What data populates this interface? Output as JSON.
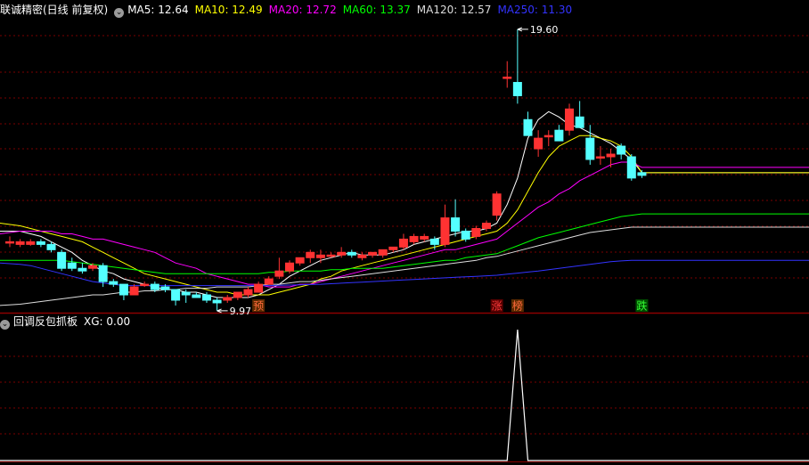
{
  "main_panel": {
    "title": "联诚精密(日线 前复权)",
    "menu_icon": "chevron-down-icon",
    "ma_legend": [
      {
        "label": "MA5: 12.64",
        "color": "#ffffff"
      },
      {
        "label": "MA10: 12.49",
        "color": "#ffff00"
      },
      {
        "label": "MA20: 12.72",
        "color": "#ff00ff"
      },
      {
        "label": "MA60: 13.37",
        "color": "#00ff00"
      },
      {
        "label": "MA120: 12.57",
        "color": "#dddddd"
      },
      {
        "label": "MA250: 11.30",
        "color": "#3333ff"
      }
    ],
    "high_label": "19.60",
    "low_label": "9.97",
    "markers": [
      {
        "text": "预",
        "bar": 24,
        "color": "#ff6a3c",
        "bg": "#5a2a00"
      },
      {
        "text": "涨",
        "bar": 47,
        "color": "#ff3b3b",
        "bg": "#5a0000"
      },
      {
        "text": "榜",
        "bar": 49,
        "color": "#ff6a3c",
        "bg": "#5a2a00"
      },
      {
        "text": "跌",
        "bar": 61,
        "color": "#33ff33",
        "bg": "#004d00"
      }
    ]
  },
  "sub_panel": {
    "title": "回调反包抓板",
    "xg_label": "XG: 0.00",
    "menu_icon": "chevron-down-icon"
  },
  "colors": {
    "up": "#ff3232",
    "down": "#54ffff",
    "grid": "#7a0000",
    "frame": "#8b0000"
  },
  "chart_data": {
    "type": "candlestick",
    "price_range": [
      9.5,
      20.1
    ],
    "ohlc": [
      [
        11.6,
        11.8,
        11.4,
        11.6
      ],
      [
        11.5,
        11.7,
        11.4,
        11.6
      ],
      [
        11.5,
        11.7,
        11.45,
        11.6
      ],
      [
        11.6,
        11.7,
        11.4,
        11.5
      ],
      [
        11.5,
        11.6,
        11.2,
        11.3
      ],
      [
        11.2,
        11.3,
        10.5,
        10.6
      ],
      [
        10.8,
        11.0,
        10.5,
        10.6
      ],
      [
        10.6,
        10.8,
        10.4,
        10.5
      ],
      [
        10.6,
        10.8,
        10.5,
        10.7
      ],
      [
        10.7,
        10.8,
        9.9,
        10.1
      ],
      [
        10.1,
        10.2,
        9.9,
        10.0
      ],
      [
        10.0,
        10.0,
        9.4,
        9.6
      ],
      [
        9.6,
        10.0,
        9.6,
        9.9
      ],
      [
        10.0,
        10.1,
        9.9,
        10.0
      ],
      [
        10.0,
        10.1,
        9.7,
        9.8
      ],
      [
        9.9,
        10.0,
        9.7,
        9.8
      ],
      [
        9.8,
        9.8,
        9.2,
        9.4
      ],
      [
        9.7,
        9.8,
        9.3,
        9.6
      ],
      [
        9.6,
        9.7,
        9.5,
        9.5
      ],
      [
        9.6,
        9.7,
        9.3,
        9.4
      ],
      [
        9.4,
        9.5,
        9.0,
        9.3
      ],
      [
        9.4,
        9.6,
        9.3,
        9.5
      ],
      [
        9.5,
        9.7,
        9.4,
        9.7
      ],
      [
        9.6,
        9.9,
        9.5,
        9.8
      ],
      [
        9.7,
        10.1,
        9.7,
        10.0
      ],
      [
        10.0,
        10.3,
        10.0,
        10.2
      ],
      [
        10.3,
        11.0,
        10.2,
        10.5
      ],
      [
        10.5,
        10.9,
        10.4,
        10.8
      ],
      [
        10.8,
        11.0,
        10.7,
        11.0
      ],
      [
        11.0,
        11.3,
        10.8,
        11.2
      ],
      [
        11.0,
        11.3,
        10.8,
        11.1
      ],
      [
        11.1,
        11.2,
        11.0,
        11.1
      ],
      [
        11.1,
        11.4,
        11.0,
        11.2
      ],
      [
        11.2,
        11.3,
        11.0,
        11.1
      ],
      [
        11.0,
        11.2,
        10.9,
        11.1
      ],
      [
        11.1,
        11.2,
        11.0,
        11.2
      ],
      [
        11.1,
        11.3,
        11.0,
        11.3
      ],
      [
        11.3,
        11.4,
        11.2,
        11.4
      ],
      [
        11.4,
        11.9,
        11.3,
        11.7
      ],
      [
        11.6,
        11.9,
        11.5,
        11.8
      ],
      [
        11.7,
        11.9,
        11.6,
        11.8
      ],
      [
        11.7,
        11.8,
        11.3,
        11.5
      ],
      [
        11.5,
        13.0,
        11.4,
        12.5
      ],
      [
        12.5,
        13.2,
        11.8,
        12.0
      ],
      [
        12.0,
        12.1,
        11.6,
        11.7
      ],
      [
        11.8,
        12.2,
        11.7,
        12.1
      ],
      [
        12.1,
        12.4,
        12.0,
        12.3
      ],
      [
        12.6,
        13.5,
        12.4,
        13.4
      ],
      [
        17.8,
        18.4,
        17.4,
        17.8
      ],
      [
        17.6,
        19.6,
        16.8,
        17.1
      ],
      [
        16.2,
        16.5,
        15.6,
        15.6
      ],
      [
        15.1,
        15.8,
        14.8,
        15.5
      ],
      [
        15.6,
        15.8,
        15.2,
        15.6
      ],
      [
        15.8,
        16.0,
        15.5,
        15.4
      ],
      [
        15.8,
        16.8,
        15.6,
        16.6
      ],
      [
        16.3,
        16.9,
        15.9,
        15.9
      ],
      [
        15.5,
        16.0,
        14.5,
        14.7
      ],
      [
        14.8,
        15.2,
        14.5,
        14.8
      ],
      [
        14.8,
        15.1,
        14.4,
        14.9
      ],
      [
        15.2,
        15.3,
        14.7,
        14.9
      ],
      [
        14.8,
        14.9,
        13.9,
        14.0
      ],
      [
        14.2,
        14.3,
        14.0,
        14.1
      ]
    ],
    "ma_series": {
      "MA5": [
        12.0,
        12.0,
        11.9,
        11.8,
        11.6,
        11.4,
        11.2,
        10.9,
        10.7,
        10.5,
        10.4,
        10.2,
        10.1,
        10.0,
        9.9,
        9.8,
        9.8,
        9.7,
        9.7,
        9.6,
        9.5,
        9.5,
        9.5,
        9.5,
        9.6,
        9.8,
        10.0,
        10.3,
        10.5,
        10.7,
        10.9,
        11.0,
        11.1,
        11.2,
        11.1,
        11.1,
        11.1,
        11.2,
        11.3,
        11.5,
        11.6,
        11.7,
        11.8,
        11.9,
        12.0,
        12.0,
        12.1,
        12.3,
        13.0,
        14.0,
        15.5,
        16.2,
        16.5,
        16.3,
        16.0,
        15.9,
        15.7,
        15.5,
        15.3,
        15.0,
        14.7,
        14.2
      ],
      "MA10": [
        12.3,
        12.2,
        12.1,
        12.0,
        11.9,
        11.8,
        11.7,
        11.6,
        11.4,
        11.2,
        11.0,
        10.8,
        10.6,
        10.4,
        10.3,
        10.2,
        10.1,
        10.0,
        9.9,
        9.8,
        9.7,
        9.7,
        9.6,
        9.6,
        9.6,
        9.6,
        9.7,
        9.8,
        9.9,
        10.0,
        10.2,
        10.3,
        10.5,
        10.6,
        10.7,
        10.8,
        10.9,
        11.0,
        11.1,
        11.2,
        11.3,
        11.4,
        11.5,
        11.6,
        11.7,
        11.8,
        11.9,
        12.0,
        12.3,
        12.8,
        13.5,
        14.2,
        14.8,
        15.2,
        15.4,
        15.6,
        15.6,
        15.5,
        15.4,
        15.2,
        14.8,
        14.2
      ],
      "MA20": [
        11.9,
        12.0,
        12.0,
        12.0,
        12.0,
        11.9,
        11.9,
        11.8,
        11.7,
        11.7,
        11.6,
        11.5,
        11.4,
        11.3,
        11.2,
        11.0,
        10.8,
        10.7,
        10.6,
        10.4,
        10.3,
        10.2,
        10.1,
        10.0,
        10.0,
        9.9,
        9.9,
        9.9,
        10.0,
        10.0,
        10.1,
        10.2,
        10.3,
        10.4,
        10.5,
        10.6,
        10.7,
        10.8,
        10.9,
        11.0,
        11.1,
        11.2,
        11.3,
        11.3,
        11.4,
        11.5,
        11.6,
        11.7,
        12.0,
        12.3,
        12.6,
        12.9,
        13.1,
        13.4,
        13.6,
        13.9,
        14.1,
        14.3,
        14.5,
        14.6,
        14.6,
        14.4
      ],
      "MA60": [
        10.9,
        10.9,
        10.9,
        10.9,
        10.9,
        10.9,
        10.85,
        10.8,
        10.75,
        10.7,
        10.65,
        10.6,
        10.55,
        10.5,
        10.45,
        10.4,
        10.4,
        10.4,
        10.4,
        10.4,
        10.4,
        10.4,
        10.4,
        10.4,
        10.4,
        10.45,
        10.45,
        10.5,
        10.5,
        10.5,
        10.5,
        10.55,
        10.55,
        10.6,
        10.6,
        10.6,
        10.6,
        10.65,
        10.7,
        10.75,
        10.8,
        10.85,
        10.9,
        10.9,
        11.0,
        11.05,
        11.1,
        11.15,
        11.3,
        11.45,
        11.6,
        11.75,
        11.85,
        11.95,
        12.05,
        12.15,
        12.25,
        12.35,
        12.45,
        12.55,
        12.6,
        12.65
      ],
      "MA120": [
        9.2,
        9.25,
        9.3,
        9.35,
        9.4,
        9.45,
        9.5,
        9.55,
        9.6,
        9.6,
        9.65,
        9.7,
        9.7,
        9.75,
        9.75,
        9.8,
        9.8,
        9.85,
        9.85,
        9.85,
        9.9,
        9.9,
        9.9,
        9.9,
        9.95,
        10.0,
        10.0,
        10.05,
        10.1,
        10.1,
        10.15,
        10.2,
        10.25,
        10.3,
        10.35,
        10.4,
        10.45,
        10.5,
        10.55,
        10.6,
        10.65,
        10.7,
        10.75,
        10.8,
        10.85,
        10.9,
        11.0,
        11.05,
        11.15,
        11.25,
        11.35,
        11.45,
        11.55,
        11.65,
        11.75,
        11.85,
        11.95,
        12.0,
        12.05,
        12.1,
        12.15,
        12.15
      ],
      "MA250": [
        10.8,
        10.75,
        10.7,
        10.6,
        10.5,
        10.4,
        10.3,
        10.2,
        10.1,
        10.05,
        10.0,
        9.95,
        9.95,
        9.95,
        9.95,
        9.95,
        9.95,
        9.95,
        9.95,
        9.95,
        9.95,
        9.95,
        9.95,
        9.95,
        9.95,
        9.95,
        9.96,
        9.97,
        9.98,
        9.99,
        10.0,
        10.02,
        10.04,
        10.06,
        10.08,
        10.1,
        10.12,
        10.14,
        10.16,
        10.18,
        10.2,
        10.22,
        10.24,
        10.26,
        10.28,
        10.3,
        10.32,
        10.34,
        10.38,
        10.42,
        10.46,
        10.5,
        10.55,
        10.6,
        10.65,
        10.7,
        10.75,
        10.8,
        10.85,
        10.88,
        10.9,
        10.9
      ]
    },
    "xg": {
      "range": [
        0,
        1
      ],
      "values": [
        0,
        0,
        0,
        0,
        0,
        0,
        0,
        0,
        0,
        0,
        0,
        0,
        0,
        0,
        0,
        0,
        0,
        0,
        0,
        0,
        0,
        0,
        0,
        0,
        0,
        0,
        0,
        0,
        0,
        0,
        0,
        0,
        0,
        0,
        0,
        0,
        0,
        0,
        0,
        0,
        0,
        0,
        0,
        0,
        0,
        0,
        0,
        0,
        0,
        1,
        0,
        0,
        0,
        0,
        0,
        0,
        0,
        0,
        0,
        0,
        0,
        0
      ]
    }
  }
}
